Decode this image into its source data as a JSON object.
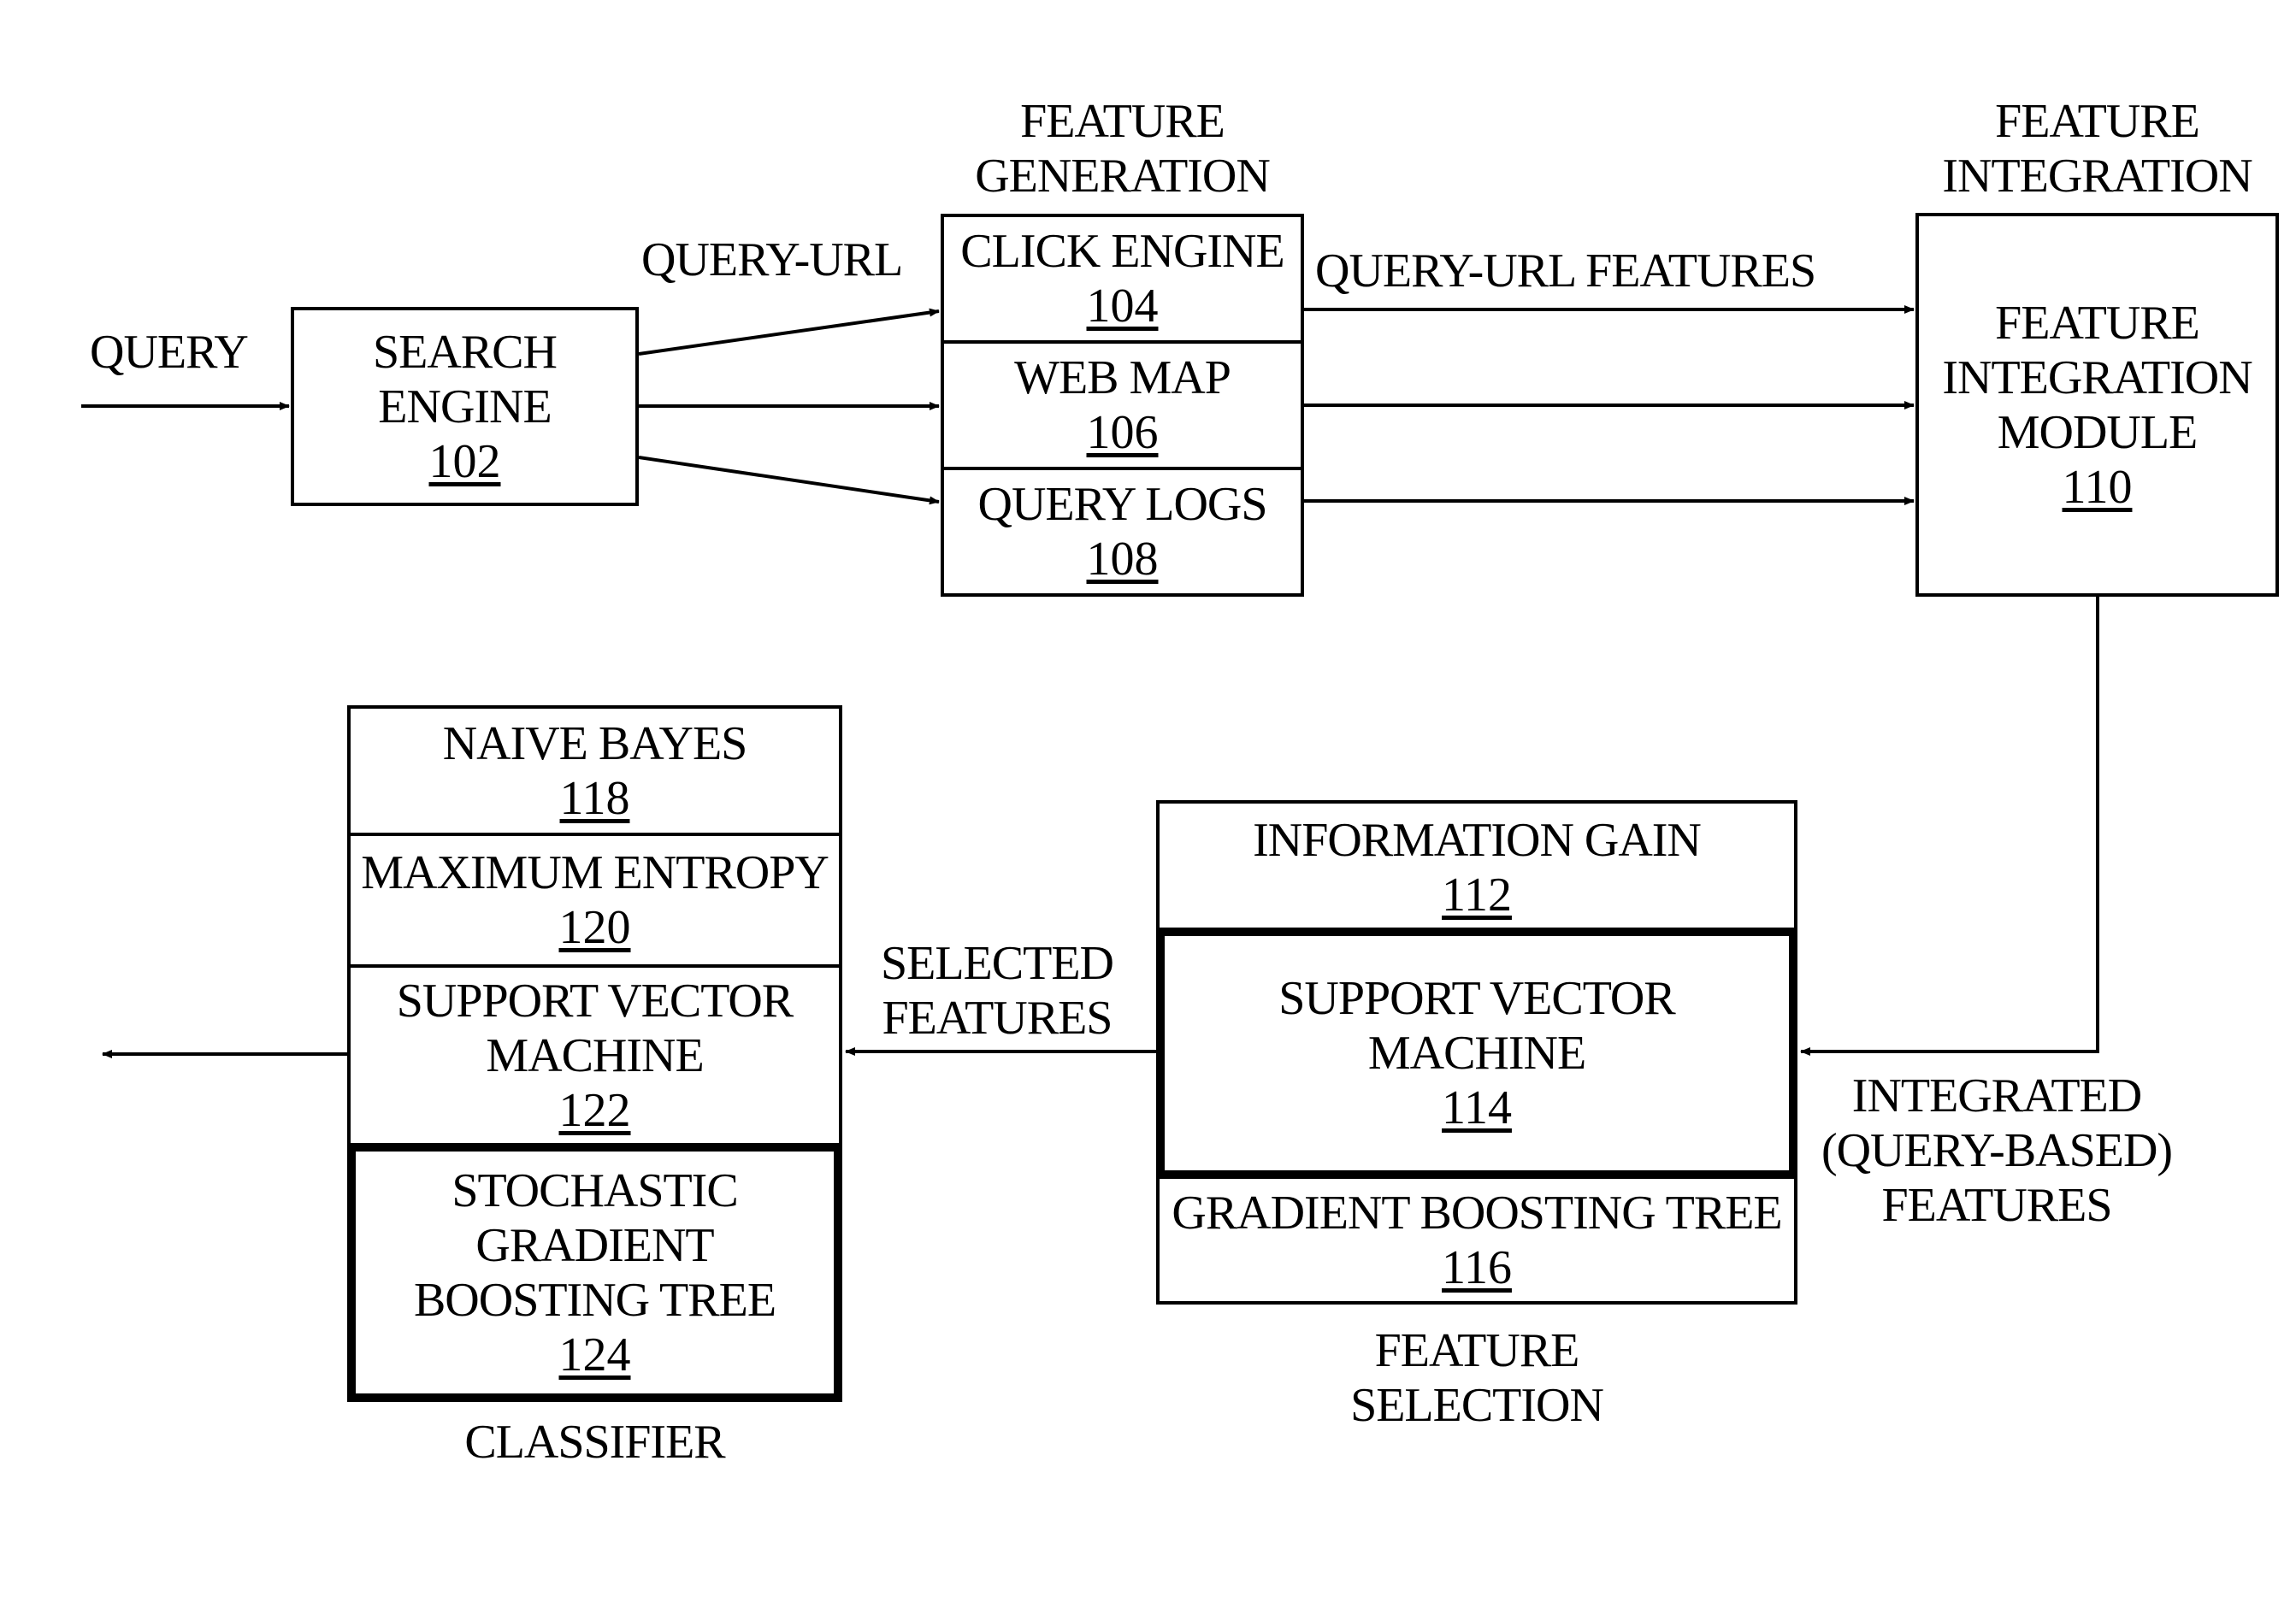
{
  "figure": {
    "type": "block-diagram",
    "stroke_color": "#000000",
    "background": "#ffffff"
  },
  "labels": {
    "query_input": "QUERY",
    "query_url": "QUERY-URL",
    "query_url_features": "QUERY-URL FEATURES",
    "selected_features": [
      "SELECTED",
      "FEATURES"
    ],
    "integrated_features": [
      "INTEGRATED",
      "(QUERY-BASED)",
      "FEATURES"
    ]
  },
  "groups": {
    "feature_generation": [
      "FEATURE",
      "GENERATION"
    ],
    "feature_integration": [
      "FEATURE",
      "INTEGRATION"
    ],
    "feature_selection": [
      "FEATURE",
      "SELECTION"
    ],
    "classifier": [
      "CLASSIFIER"
    ]
  },
  "blocks": {
    "search_engine": {
      "lines": [
        "SEARCH",
        "ENGINE"
      ],
      "ref": "102"
    },
    "click_engine": {
      "lines": [
        "CLICK ENGINE"
      ],
      "ref": "104"
    },
    "web_map": {
      "lines": [
        "WEB MAP"
      ],
      "ref": "106"
    },
    "query_logs": {
      "lines": [
        "QUERY LOGS"
      ],
      "ref": "108"
    },
    "feature_integration_module": {
      "lines": [
        "FEATURE",
        "INTEGRATION",
        "MODULE"
      ],
      "ref": "110"
    },
    "information_gain": {
      "lines": [
        "INFORMATION GAIN"
      ],
      "ref": "112"
    },
    "fs_support_vector_machine": {
      "lines": [
        "SUPPORT VECTOR",
        "MACHINE"
      ],
      "ref": "114",
      "selected": true
    },
    "gradient_boosting_tree": {
      "lines": [
        "GRADIENT BOOSTING TREE"
      ],
      "ref": "116"
    },
    "naive_bayes": {
      "lines": [
        "NAIVE BAYES"
      ],
      "ref": "118"
    },
    "maximum_entropy": {
      "lines": [
        "MAXIMUM ENTROPY"
      ],
      "ref": "120"
    },
    "cl_support_vector_machine": {
      "lines": [
        "SUPPORT VECTOR",
        "MACHINE"
      ],
      "ref": "122"
    },
    "stochastic_gradient_boosting_tree": {
      "lines": [
        "STOCHASTIC",
        "GRADIENT",
        "BOOSTING TREE"
      ],
      "ref": "124",
      "selected": true
    }
  },
  "connections": [
    {
      "from": "input",
      "to": "search_engine",
      "label": "QUERY"
    },
    {
      "from": "search_engine",
      "to": "click_engine",
      "label": "QUERY-URL"
    },
    {
      "from": "search_engine",
      "to": "web_map"
    },
    {
      "from": "search_engine",
      "to": "query_logs"
    },
    {
      "from": "click_engine",
      "to": "feature_integration_module",
      "label": "QUERY-URL FEATURES"
    },
    {
      "from": "web_map",
      "to": "feature_integration_module"
    },
    {
      "from": "query_logs",
      "to": "feature_integration_module"
    },
    {
      "from": "feature_integration_module",
      "to": "feature_selection",
      "label": "INTEGRATED (QUERY-BASED) FEATURES"
    },
    {
      "from": "feature_selection",
      "to": "classifier",
      "label": "SELECTED FEATURES"
    },
    {
      "from": "classifier",
      "to": "output"
    }
  ]
}
